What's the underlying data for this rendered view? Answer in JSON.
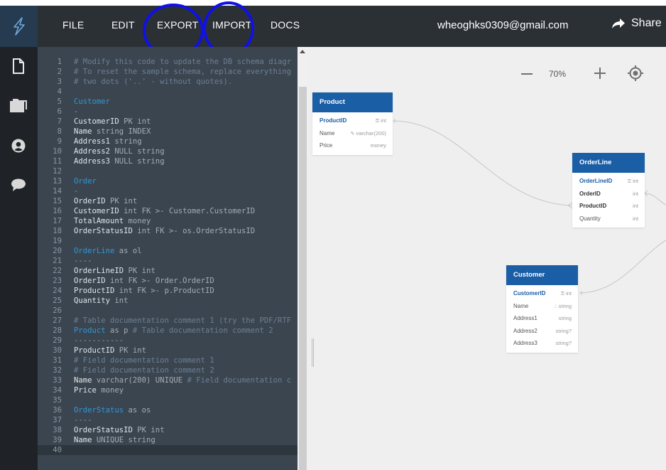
{
  "nav": {
    "file": "FILE",
    "edit": "EDIT",
    "export": "EXPORT",
    "import": "IMPORT",
    "docs": "DOCS",
    "email": "wheoghks0309@gmail.com",
    "share": "Share"
  },
  "sidebar": {
    "logo_icon": "lightning-bolt-icon",
    "icons": [
      "document-icon",
      "folder-icon",
      "user-icon",
      "chat-icon"
    ]
  },
  "colors": {
    "accent": "#1a5ea6",
    "editor_bg": "#3b4550",
    "nav_bg": "#2b3035",
    "annotation": "#1010e8"
  },
  "editor": {
    "lines": [
      {
        "n": "1",
        "t": "# Modify this code to update the DB schema diagr",
        "k": "comment"
      },
      {
        "n": "2",
        "t": "# To reset the sample schema, replace everything",
        "k": "comment"
      },
      {
        "n": "3",
        "t": "# two dots ('..' - without quotes).",
        "k": "comment"
      },
      {
        "n": "4",
        "t": "",
        "k": "field"
      },
      {
        "n": "5",
        "t": "Customer",
        "k": "table"
      },
      {
        "n": "6",
        "t": "-",
        "k": "dash"
      },
      {
        "n": "7",
        "t": "CustomerID",
        "r": " PK int",
        "k": "field"
      },
      {
        "n": "8",
        "t": "Name",
        "r": " string INDEX",
        "k": "field"
      },
      {
        "n": "9",
        "t": "Address1",
        "r": " string",
        "k": "field"
      },
      {
        "n": "10",
        "t": "Address2",
        "r": " NULL string",
        "k": "field"
      },
      {
        "n": "11",
        "t": "Address3",
        "r": " NULL string",
        "k": "field"
      },
      {
        "n": "12",
        "t": "",
        "k": "field"
      },
      {
        "n": "13",
        "t": "Order",
        "k": "table"
      },
      {
        "n": "14",
        "t": "-",
        "k": "dash"
      },
      {
        "n": "15",
        "t": "OrderID",
        "r": " PK int",
        "k": "field"
      },
      {
        "n": "16",
        "t": "CustomerID",
        "r": " int FK >- Customer.CustomerID",
        "k": "field"
      },
      {
        "n": "17",
        "t": "TotalAmount",
        "r": " money",
        "k": "field"
      },
      {
        "n": "18",
        "t": "OrderStatusID",
        "r": " int FK >- os.OrderStatusID",
        "k": "field"
      },
      {
        "n": "19",
        "t": "",
        "k": "field"
      },
      {
        "n": "20",
        "t": "OrderLine",
        "r": " as ol",
        "k": "table"
      },
      {
        "n": "21",
        "t": "----",
        "k": "dash"
      },
      {
        "n": "22",
        "t": "OrderLineID",
        "r": " PK int",
        "k": "field"
      },
      {
        "n": "23",
        "t": "OrderID",
        "r": " int FK >- Order.OrderID",
        "k": "field"
      },
      {
        "n": "24",
        "t": "ProductID",
        "r": " int FK >- p.ProductID",
        "k": "field"
      },
      {
        "n": "25",
        "t": "Quantity",
        "r": " int",
        "k": "field"
      },
      {
        "n": "26",
        "t": "",
        "k": "field"
      },
      {
        "n": "27",
        "t": "# Table documentation comment 1 (try the PDF/RTF",
        "k": "comment"
      },
      {
        "n": "28",
        "t": "Product",
        "r": " as p",
        "c": " # Table documentation comment 2",
        "k": "table"
      },
      {
        "n": "29",
        "t": "-----------",
        "k": "dash"
      },
      {
        "n": "30",
        "t": "ProductID",
        "r": " PK int",
        "k": "field"
      },
      {
        "n": "31",
        "t": "# Field documentation comment 1",
        "k": "comment"
      },
      {
        "n": "32",
        "t": "# Field documentation comment 2",
        "k": "comment"
      },
      {
        "n": "33",
        "t": "Name",
        "r": " varchar(200) UNIQUE",
        "c": " # Field documentation c",
        "k": "field"
      },
      {
        "n": "34",
        "t": "Price",
        "r": " money",
        "k": "field"
      },
      {
        "n": "35",
        "t": "",
        "k": "field"
      },
      {
        "n": "36",
        "t": "OrderStatus",
        "r": " as os",
        "k": "table"
      },
      {
        "n": "37",
        "t": "----",
        "k": "dash"
      },
      {
        "n": "38",
        "t": "OrderStatusID",
        "r": " PK int",
        "k": "field"
      },
      {
        "n": "39",
        "t": "Name",
        "r": " UNIQUE string",
        "k": "field"
      },
      {
        "n": "40",
        "t": "",
        "k": "field"
      }
    ]
  },
  "canvas": {
    "zoom": "70%",
    "tables": [
      {
        "name": "Product",
        "fields": [
          {
            "name": "ProductID",
            "type": "int",
            "kind": "pk",
            "icon": "key-icon"
          },
          {
            "name": "Name",
            "type": "varchar(200)",
            "kind": "plain",
            "icon": "unique-icon"
          },
          {
            "name": "Price",
            "type": "money",
            "kind": "plain"
          }
        ]
      },
      {
        "name": "OrderLine",
        "fields": [
          {
            "name": "OrderLineID",
            "type": "int",
            "kind": "pk",
            "icon": "key-icon"
          },
          {
            "name": "OrderID",
            "type": "int",
            "kind": "fk"
          },
          {
            "name": "ProductID",
            "type": "int",
            "kind": "fk"
          },
          {
            "name": "Quantity",
            "type": "int",
            "kind": "plain"
          }
        ]
      },
      {
        "name": "Customer",
        "fields": [
          {
            "name": "CustomerID",
            "type": "int",
            "kind": "pk",
            "icon": "key-icon"
          },
          {
            "name": "Name",
            "type": "string",
            "kind": "plain",
            "icon": "index-icon"
          },
          {
            "name": "Address1",
            "type": "string",
            "kind": "plain"
          },
          {
            "name": "Address2",
            "type": "string?",
            "kind": "plain"
          },
          {
            "name": "Address3",
            "type": "string?",
            "kind": "plain"
          }
        ]
      }
    ]
  }
}
